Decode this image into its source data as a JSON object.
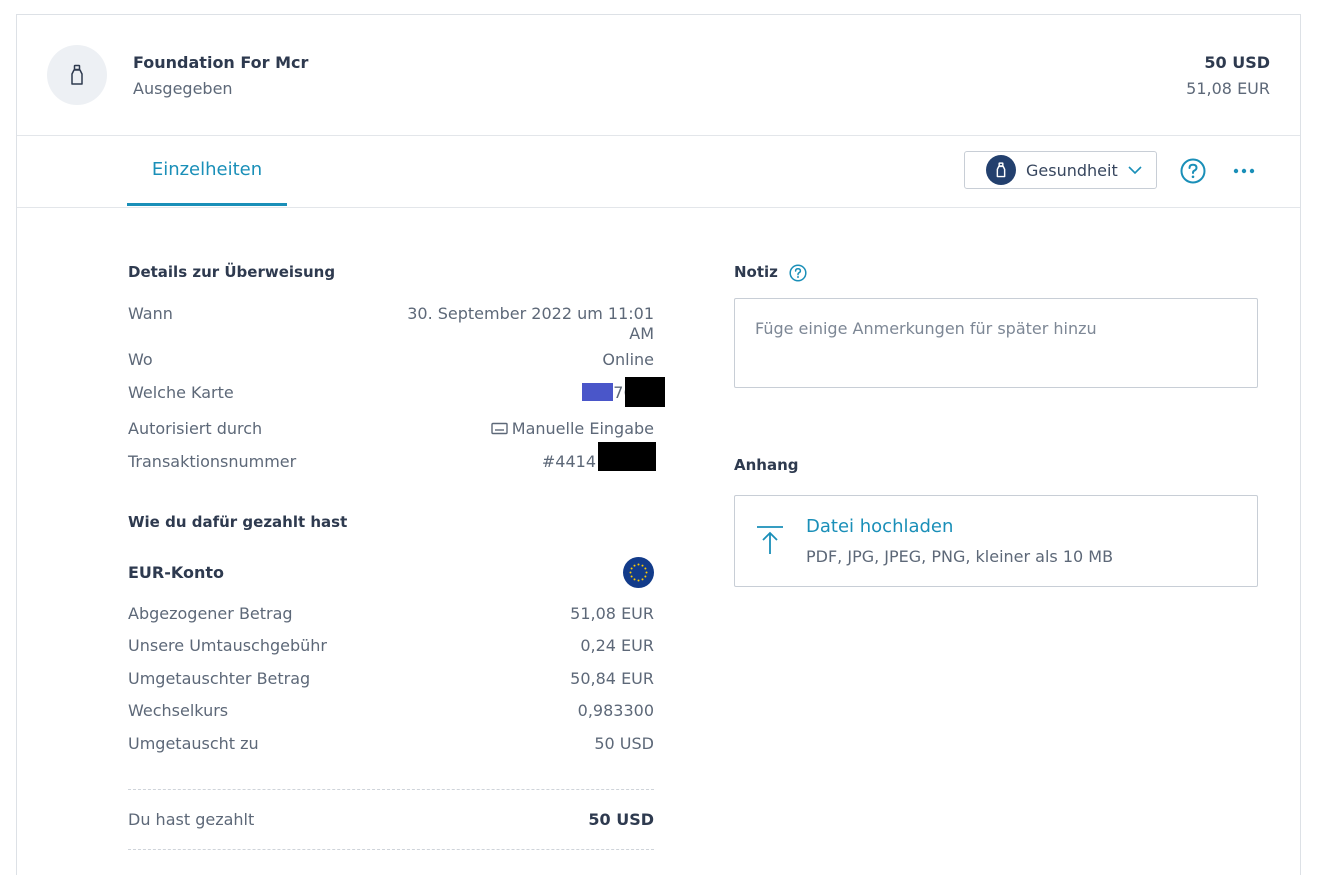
{
  "header": {
    "merchant": "Foundation For Mcr",
    "status": "Ausgegeben",
    "amount_primary": "50 USD",
    "amount_secondary": "51,08 EUR",
    "icon": "bottle-icon"
  },
  "tabs": [
    {
      "label": "Einzelheiten",
      "active": true
    }
  ],
  "category": {
    "label": "Gesundheit",
    "icon": "bottle-icon"
  },
  "transfer_details": {
    "title": "Details zur Überweisung",
    "rows": [
      {
        "label": "Wann",
        "value_line1": "30. September 2022 um 11:01",
        "value_line2": "AM"
      },
      {
        "label": "Wo",
        "value": "Online"
      },
      {
        "label": "Welche Karte",
        "value": "7651"
      },
      {
        "label": "Autorisiert durch",
        "value": "Manuelle Eingabe",
        "icon": "keyboard-icon"
      },
      {
        "label": "Transaktionsnummer",
        "value": "#4414"
      }
    ]
  },
  "payment": {
    "title": "Wie du dafür gezahlt hast",
    "account": "EUR-Konto",
    "account_icon": "eu-flag-icon",
    "rows": [
      {
        "label": "Abgezogener Betrag",
        "value": "51,08 EUR"
      },
      {
        "label": "Unsere Umtauschgebühr",
        "value": "0,24 EUR"
      },
      {
        "label": "Umgetauschter Betrag",
        "value": "50,84 EUR"
      },
      {
        "label": "Wechselkurs",
        "value": "0,983300"
      },
      {
        "label": "Umgetauscht zu",
        "value": "50 USD"
      }
    ],
    "total": {
      "label": "Du hast gezahlt",
      "value": "50 USD"
    }
  },
  "note": {
    "title": "Notiz",
    "value": "",
    "placeholder": "Füge einige Anmerkungen für später hinzu"
  },
  "attachment": {
    "title": "Anhang",
    "upload_label": "Datei hochladen",
    "upload_hint": "PDF, JPG, JPEG, PNG, kleiner als 10 MB"
  },
  "colors": {
    "accent": "#1a8fb8",
    "text_dark": "#2e3a4f",
    "text_muted": "#5d6878",
    "card_brand": "#4a56c9",
    "category_bg": "#23406e",
    "eu_blue": "#123b8a",
    "eu_stars": "#ffcc00"
  }
}
